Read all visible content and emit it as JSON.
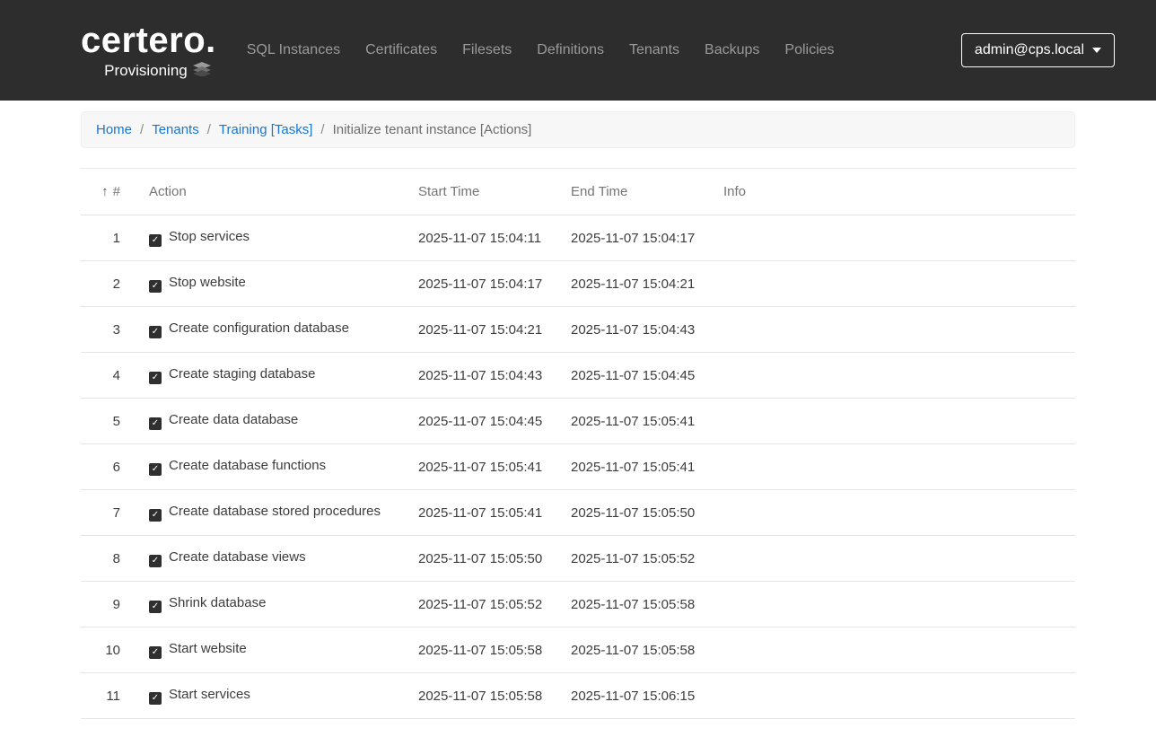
{
  "navbar": {
    "logo": "certero.",
    "logo_sub": "Provisioning",
    "items": [
      "SQL Instances",
      "Certificates",
      "Filesets",
      "Definitions",
      "Tenants",
      "Backups",
      "Policies"
    ],
    "user_menu_label": "admin@cps.local"
  },
  "breadcrumb": {
    "separator": "/",
    "items": [
      {
        "label": "Home"
      },
      {
        "label": "Tenants"
      },
      {
        "label": "Training [Tasks]"
      },
      {
        "label": "Initialize tenant instance [Actions]"
      }
    ]
  },
  "icons": {
    "check": "✓",
    "sort_up": "↑"
  },
  "colors": {
    "navbar_bg": "#2d2d2d",
    "link_blue": "#1976d2",
    "breadcrumb_bg": "#f7f7f7",
    "header_text": "#757575",
    "row_border": "#e5e5e5"
  },
  "table": {
    "columns": {
      "num": "#",
      "action": "Action",
      "start": "Start Time",
      "end": "End Time",
      "info": "Info"
    },
    "rows": [
      {
        "num": "1",
        "action": "Stop services",
        "start": "2025-11-07 15:04:11",
        "end": "2025-11-07 15:04:17",
        "info": ""
      },
      {
        "num": "2",
        "action": "Stop website",
        "start": "2025-11-07 15:04:17",
        "end": "2025-11-07 15:04:21",
        "info": ""
      },
      {
        "num": "3",
        "action": "Create configuration database",
        "start": "2025-11-07 15:04:21",
        "end": "2025-11-07 15:04:43",
        "info": ""
      },
      {
        "num": "4",
        "action": "Create staging database",
        "start": "2025-11-07 15:04:43",
        "end": "2025-11-07 15:04:45",
        "info": ""
      },
      {
        "num": "5",
        "action": "Create data database",
        "start": "2025-11-07 15:04:45",
        "end": "2025-11-07 15:05:41",
        "info": ""
      },
      {
        "num": "6",
        "action": "Create database functions",
        "start": "2025-11-07 15:05:41",
        "end": "2025-11-07 15:05:41",
        "info": ""
      },
      {
        "num": "7",
        "action": "Create database stored procedures",
        "start": "2025-11-07 15:05:41",
        "end": "2025-11-07 15:05:50",
        "info": ""
      },
      {
        "num": "8",
        "action": "Create database views",
        "start": "2025-11-07 15:05:50",
        "end": "2025-11-07 15:05:52",
        "info": ""
      },
      {
        "num": "9",
        "action": "Shrink database",
        "start": "2025-11-07 15:05:52",
        "end": "2025-11-07 15:05:58",
        "info": ""
      },
      {
        "num": "10",
        "action": "Start website",
        "start": "2025-11-07 15:05:58",
        "end": "2025-11-07 15:05:58",
        "info": ""
      },
      {
        "num": "11",
        "action": "Start services",
        "start": "2025-11-07 15:05:58",
        "end": "2025-11-07 15:06:15",
        "info": ""
      }
    ]
  }
}
